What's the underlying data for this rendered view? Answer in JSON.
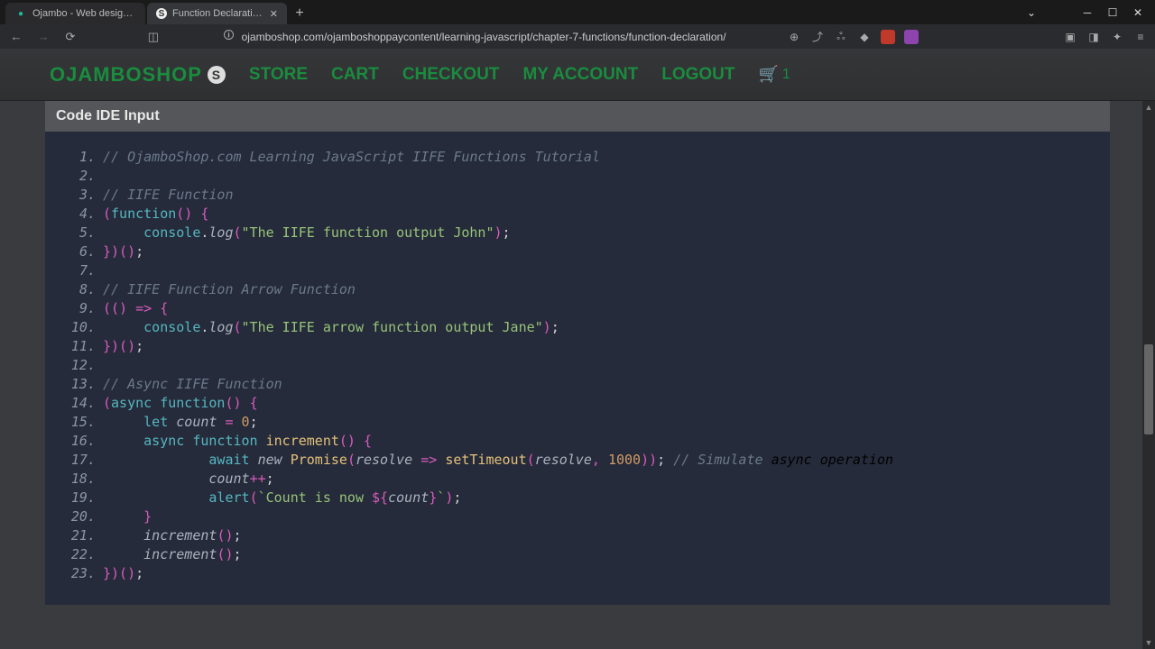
{
  "titlebar": {
    "tabs": [
      {
        "label": "Ojambo - Web design, Program",
        "active": false
      },
      {
        "label": "Function Declaration - Oja",
        "active": true
      }
    ]
  },
  "url": "ojamboshop.com/ojamboshoppaycontent/learning-javascript/chapter-7-functions/function-declaration/",
  "nav": {
    "brand": "OJAMBOSHOP",
    "links": [
      "STORE",
      "CART",
      "CHECKOUT",
      "MY ACCOUNT",
      "LOGOUT"
    ],
    "cart_count": "1"
  },
  "ide": {
    "title": "Code IDE Input"
  },
  "code": [
    [
      [
        "c",
        "// OjamboShop.com Learning JavaScript IIFE Functions Tutorial"
      ]
    ],
    [],
    [
      [
        "c",
        "// IIFE Function"
      ]
    ],
    [
      [
        "p",
        "("
      ],
      [
        "b",
        "function"
      ],
      [
        "p",
        "()"
      ],
      [
        "w",
        " "
      ],
      [
        "p",
        "{"
      ]
    ],
    [
      [
        "w",
        "     "
      ],
      [
        "b",
        "console"
      ],
      [
        "w",
        "."
      ],
      [
        "i",
        "log"
      ],
      [
        "p",
        "("
      ],
      [
        "g",
        "\"The IIFE function output John\""
      ],
      [
        "p",
        ")"
      ],
      [
        "w",
        ";"
      ]
    ],
    [
      [
        "p",
        "})()"
      ],
      [
        "w",
        ";"
      ]
    ],
    [],
    [
      [
        "c",
        "// IIFE Function Arrow Function"
      ]
    ],
    [
      [
        "p",
        "(()"
      ],
      [
        "w",
        " "
      ],
      [
        "p",
        "=>"
      ],
      [
        "w",
        " "
      ],
      [
        "p",
        "{"
      ]
    ],
    [
      [
        "w",
        "     "
      ],
      [
        "b",
        "console"
      ],
      [
        "w",
        "."
      ],
      [
        "i",
        "log"
      ],
      [
        "p",
        "("
      ],
      [
        "g",
        "\"The IIFE arrow function output Jane\""
      ],
      [
        "p",
        ")"
      ],
      [
        "w",
        ";"
      ]
    ],
    [
      [
        "p",
        "})()"
      ],
      [
        "w",
        ";"
      ]
    ],
    [],
    [
      [
        "c",
        "// Async IIFE Function"
      ]
    ],
    [
      [
        "p",
        "("
      ],
      [
        "b",
        "async "
      ],
      [
        "b",
        "function"
      ],
      [
        "p",
        "()"
      ],
      [
        "w",
        " "
      ],
      [
        "p",
        "{"
      ]
    ],
    [
      [
        "w",
        "     "
      ],
      [
        "b",
        "let "
      ],
      [
        "i",
        "count"
      ],
      [
        "w",
        " "
      ],
      [
        "p",
        "="
      ],
      [
        "w",
        " "
      ],
      [
        "n",
        "0"
      ],
      [
        "w",
        ";"
      ]
    ],
    [
      [
        "w",
        "     "
      ],
      [
        "b",
        "async "
      ],
      [
        "b",
        "function "
      ],
      [
        "y",
        "increment"
      ],
      [
        "p",
        "()"
      ],
      [
        "w",
        " "
      ],
      [
        "p",
        "{"
      ]
    ],
    [
      [
        "w",
        "             "
      ],
      [
        "b",
        "await "
      ],
      [
        "i",
        "new "
      ],
      [
        "y",
        "Promise"
      ],
      [
        "p",
        "("
      ],
      [
        "i",
        "resolve"
      ],
      [
        "w",
        " "
      ],
      [
        "p",
        "=>"
      ],
      [
        "w",
        " "
      ],
      [
        "y",
        "setTimeout"
      ],
      [
        "p",
        "("
      ],
      [
        "i",
        "resolve"
      ],
      [
        "p",
        ","
      ],
      [
        "w",
        " "
      ],
      [
        "n",
        "1000"
      ],
      [
        "p",
        "))"
      ],
      [
        "w",
        "; "
      ],
      [
        "c",
        "// Simulate"
      ],
      [
        "w",
        " "
      ],
      [
        "it",
        "async operation"
      ]
    ],
    [
      [
        "w",
        "             "
      ],
      [
        "i",
        "count"
      ],
      [
        "p",
        "++"
      ],
      [
        "w",
        ";"
      ]
    ],
    [
      [
        "w",
        "             "
      ],
      [
        "b",
        "alert"
      ],
      [
        "p",
        "("
      ],
      [
        "g",
        "`Count is now "
      ],
      [
        "p",
        "${"
      ],
      [
        "i",
        "count"
      ],
      [
        "p",
        "}"
      ],
      [
        "g",
        "`"
      ],
      [
        "p",
        ")"
      ],
      [
        "w",
        ";"
      ]
    ],
    [
      [
        "w",
        "     "
      ],
      [
        "p",
        "}"
      ]
    ],
    [
      [
        "w",
        "     "
      ],
      [
        "i",
        "increment"
      ],
      [
        "p",
        "()"
      ],
      [
        "w",
        ";"
      ]
    ],
    [
      [
        "w",
        "     "
      ],
      [
        "i",
        "increment"
      ],
      [
        "p",
        "()"
      ],
      [
        "w",
        ";"
      ]
    ],
    [
      [
        "p",
        "})()"
      ],
      [
        "w",
        ";"
      ]
    ]
  ]
}
